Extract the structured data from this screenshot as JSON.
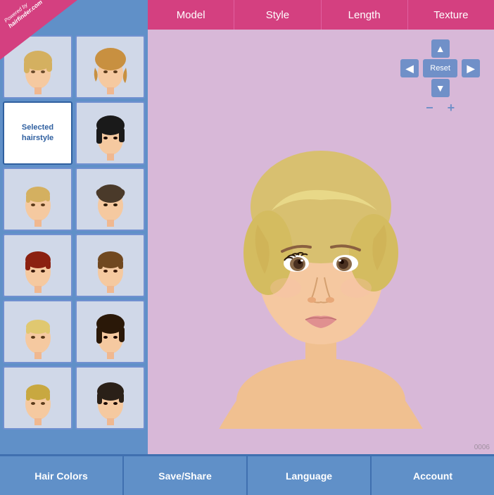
{
  "brand": {
    "line1": "Powered by",
    "line2": "hairfinder.com"
  },
  "nav": {
    "items": [
      {
        "id": "model",
        "label": "Model"
      },
      {
        "id": "style",
        "label": "Style"
      },
      {
        "id": "length",
        "label": "Length"
      },
      {
        "id": "texture",
        "label": "Texture"
      }
    ]
  },
  "controls": {
    "reset": "Reset",
    "zoom_minus": "−",
    "zoom_plus": "+"
  },
  "sidebar": {
    "selected_label_line1": "Selected",
    "selected_label_line2": "hairstyle",
    "thumbs": [
      {
        "id": "thumb-1",
        "alt": "Hairstyle 1"
      },
      {
        "id": "thumb-2",
        "alt": "Hairstyle 2"
      },
      {
        "id": "thumb-3",
        "alt": "Hairstyle 3 selected",
        "selected": true
      },
      {
        "id": "thumb-4",
        "alt": "Hairstyle 4"
      },
      {
        "id": "thumb-5",
        "alt": "Hairstyle 5"
      },
      {
        "id": "thumb-6",
        "alt": "Hairstyle 6"
      },
      {
        "id": "thumb-7",
        "alt": "Hairstyle 7"
      },
      {
        "id": "thumb-8",
        "alt": "Hairstyle 8"
      },
      {
        "id": "thumb-9",
        "alt": "Hairstyle 9"
      },
      {
        "id": "thumb-10",
        "alt": "Hairstyle 10"
      },
      {
        "id": "thumb-11",
        "alt": "Hairstyle 11"
      },
      {
        "id": "thumb-12",
        "alt": "Hairstyle 12"
      }
    ]
  },
  "bottom": {
    "items": [
      {
        "id": "hair-colors",
        "label": "Hair Colors"
      },
      {
        "id": "save-share",
        "label": "Save/Share"
      },
      {
        "id": "language",
        "label": "Language"
      },
      {
        "id": "account",
        "label": "Account"
      }
    ]
  },
  "image_number": "0006",
  "colors": {
    "pink": "#d44080",
    "blue": "#6090c8",
    "bg": "#d8b8d8"
  }
}
